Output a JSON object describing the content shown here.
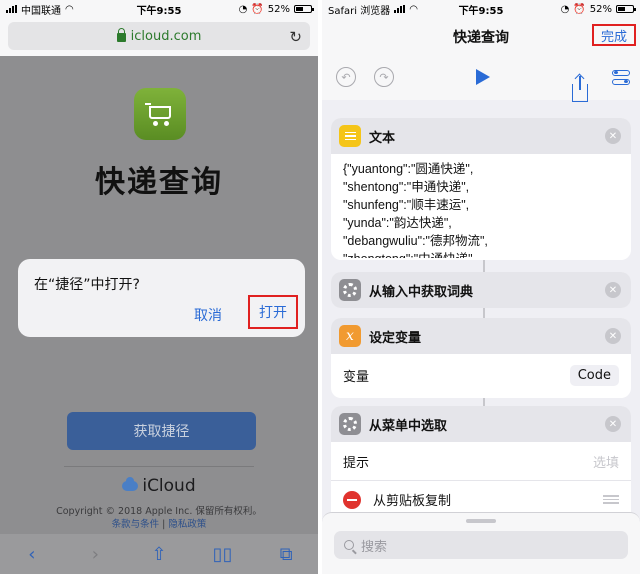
{
  "left": {
    "status": {
      "carrier": "中国联通",
      "time": "下午9:55",
      "battery": "52%",
      "battery_level": 0.52
    },
    "url": "icloud.com",
    "reload_icon": "reload-icon",
    "page": {
      "title": "快递查询",
      "get_button": "获取捷径",
      "brand": "iCloud",
      "copyright": "Copyright © 2018 Apple Inc. 保留所有权利。",
      "terms": "条款与条件",
      "privacy": "隐私政策"
    },
    "dialog": {
      "title": "在“捷径”中打开?",
      "cancel": "取消",
      "open": "打开"
    },
    "toolbar": {
      "back": "‹",
      "forward": "›",
      "share": "⇧",
      "bookmarks": "📖",
      "tabs": "⧉"
    }
  },
  "right": {
    "status": {
      "carrier": "Safari 浏览器",
      "time": "下午9:55",
      "battery": "52%",
      "battery_level": 0.52
    },
    "nav": {
      "title": "快递查询",
      "done": "完成"
    },
    "actions": {
      "text": {
        "title": "文本",
        "content": "{\"yuantong\":\"圆通快递\",\n\"shentong\":\"申通快递\",\n\"shunfeng\":\"顺丰速运\",\n\"yunda\":\"韵达快递\",\n\"debangwuliu\":\"德邦物流\",\n\"zhongtong\":\"中通快递\""
      },
      "dict": {
        "title": "从输入中获取词典"
      },
      "setvar": {
        "title": "设定变量",
        "label": "变量",
        "value": "Code"
      },
      "menu": {
        "title": "从菜单中选取",
        "prompt_label": "提示",
        "prompt_placeholder": "选填",
        "item1": "从剪贴板复制"
      }
    },
    "search": {
      "placeholder": "搜索"
    }
  },
  "colors": {
    "accent": "#2a6bd6",
    "highlight": "#e02020",
    "brand_green": "#6da22e"
  }
}
